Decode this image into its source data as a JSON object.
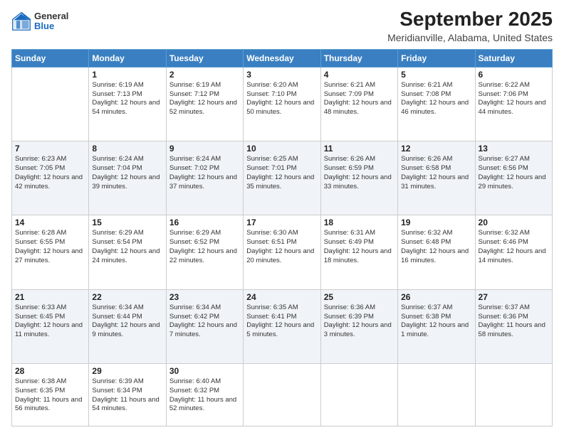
{
  "logo": {
    "general": "General",
    "blue": "Blue"
  },
  "title": "September 2025",
  "subtitle": "Meridianville, Alabama, United States",
  "weekdays": [
    "Sunday",
    "Monday",
    "Tuesday",
    "Wednesday",
    "Thursday",
    "Friday",
    "Saturday"
  ],
  "rows": [
    [
      {
        "day": "",
        "sunrise": "",
        "sunset": "",
        "daylight": "",
        "empty": true
      },
      {
        "day": "1",
        "sunrise": "Sunrise: 6:19 AM",
        "sunset": "Sunset: 7:13 PM",
        "daylight": "Daylight: 12 hours and 54 minutes."
      },
      {
        "day": "2",
        "sunrise": "Sunrise: 6:19 AM",
        "sunset": "Sunset: 7:12 PM",
        "daylight": "Daylight: 12 hours and 52 minutes."
      },
      {
        "day": "3",
        "sunrise": "Sunrise: 6:20 AM",
        "sunset": "Sunset: 7:10 PM",
        "daylight": "Daylight: 12 hours and 50 minutes."
      },
      {
        "day": "4",
        "sunrise": "Sunrise: 6:21 AM",
        "sunset": "Sunset: 7:09 PM",
        "daylight": "Daylight: 12 hours and 48 minutes."
      },
      {
        "day": "5",
        "sunrise": "Sunrise: 6:21 AM",
        "sunset": "Sunset: 7:08 PM",
        "daylight": "Daylight: 12 hours and 46 minutes."
      },
      {
        "day": "6",
        "sunrise": "Sunrise: 6:22 AM",
        "sunset": "Sunset: 7:06 PM",
        "daylight": "Daylight: 12 hours and 44 minutes."
      }
    ],
    [
      {
        "day": "7",
        "sunrise": "Sunrise: 6:23 AM",
        "sunset": "Sunset: 7:05 PM",
        "daylight": "Daylight: 12 hours and 42 minutes."
      },
      {
        "day": "8",
        "sunrise": "Sunrise: 6:24 AM",
        "sunset": "Sunset: 7:04 PM",
        "daylight": "Daylight: 12 hours and 39 minutes."
      },
      {
        "day": "9",
        "sunrise": "Sunrise: 6:24 AM",
        "sunset": "Sunset: 7:02 PM",
        "daylight": "Daylight: 12 hours and 37 minutes."
      },
      {
        "day": "10",
        "sunrise": "Sunrise: 6:25 AM",
        "sunset": "Sunset: 7:01 PM",
        "daylight": "Daylight: 12 hours and 35 minutes."
      },
      {
        "day": "11",
        "sunrise": "Sunrise: 6:26 AM",
        "sunset": "Sunset: 6:59 PM",
        "daylight": "Daylight: 12 hours and 33 minutes."
      },
      {
        "day": "12",
        "sunrise": "Sunrise: 6:26 AM",
        "sunset": "Sunset: 6:58 PM",
        "daylight": "Daylight: 12 hours and 31 minutes."
      },
      {
        "day": "13",
        "sunrise": "Sunrise: 6:27 AM",
        "sunset": "Sunset: 6:56 PM",
        "daylight": "Daylight: 12 hours and 29 minutes."
      }
    ],
    [
      {
        "day": "14",
        "sunrise": "Sunrise: 6:28 AM",
        "sunset": "Sunset: 6:55 PM",
        "daylight": "Daylight: 12 hours and 27 minutes."
      },
      {
        "day": "15",
        "sunrise": "Sunrise: 6:29 AM",
        "sunset": "Sunset: 6:54 PM",
        "daylight": "Daylight: 12 hours and 24 minutes."
      },
      {
        "day": "16",
        "sunrise": "Sunrise: 6:29 AM",
        "sunset": "Sunset: 6:52 PM",
        "daylight": "Daylight: 12 hours and 22 minutes."
      },
      {
        "day": "17",
        "sunrise": "Sunrise: 6:30 AM",
        "sunset": "Sunset: 6:51 PM",
        "daylight": "Daylight: 12 hours and 20 minutes."
      },
      {
        "day": "18",
        "sunrise": "Sunrise: 6:31 AM",
        "sunset": "Sunset: 6:49 PM",
        "daylight": "Daylight: 12 hours and 18 minutes."
      },
      {
        "day": "19",
        "sunrise": "Sunrise: 6:32 AM",
        "sunset": "Sunset: 6:48 PM",
        "daylight": "Daylight: 12 hours and 16 minutes."
      },
      {
        "day": "20",
        "sunrise": "Sunrise: 6:32 AM",
        "sunset": "Sunset: 6:46 PM",
        "daylight": "Daylight: 12 hours and 14 minutes."
      }
    ],
    [
      {
        "day": "21",
        "sunrise": "Sunrise: 6:33 AM",
        "sunset": "Sunset: 6:45 PM",
        "daylight": "Daylight: 12 hours and 11 minutes."
      },
      {
        "day": "22",
        "sunrise": "Sunrise: 6:34 AM",
        "sunset": "Sunset: 6:44 PM",
        "daylight": "Daylight: 12 hours and 9 minutes."
      },
      {
        "day": "23",
        "sunrise": "Sunrise: 6:34 AM",
        "sunset": "Sunset: 6:42 PM",
        "daylight": "Daylight: 12 hours and 7 minutes."
      },
      {
        "day": "24",
        "sunrise": "Sunrise: 6:35 AM",
        "sunset": "Sunset: 6:41 PM",
        "daylight": "Daylight: 12 hours and 5 minutes."
      },
      {
        "day": "25",
        "sunrise": "Sunrise: 6:36 AM",
        "sunset": "Sunset: 6:39 PM",
        "daylight": "Daylight: 12 hours and 3 minutes."
      },
      {
        "day": "26",
        "sunrise": "Sunrise: 6:37 AM",
        "sunset": "Sunset: 6:38 PM",
        "daylight": "Daylight: 12 hours and 1 minute."
      },
      {
        "day": "27",
        "sunrise": "Sunrise: 6:37 AM",
        "sunset": "Sunset: 6:36 PM",
        "daylight": "Daylight: 11 hours and 58 minutes."
      }
    ],
    [
      {
        "day": "28",
        "sunrise": "Sunrise: 6:38 AM",
        "sunset": "Sunset: 6:35 PM",
        "daylight": "Daylight: 11 hours and 56 minutes."
      },
      {
        "day": "29",
        "sunrise": "Sunrise: 6:39 AM",
        "sunset": "Sunset: 6:34 PM",
        "daylight": "Daylight: 11 hours and 54 minutes."
      },
      {
        "day": "30",
        "sunrise": "Sunrise: 6:40 AM",
        "sunset": "Sunset: 6:32 PM",
        "daylight": "Daylight: 11 hours and 52 minutes."
      },
      {
        "day": "",
        "sunrise": "",
        "sunset": "",
        "daylight": "",
        "empty": true
      },
      {
        "day": "",
        "sunrise": "",
        "sunset": "",
        "daylight": "",
        "empty": true
      },
      {
        "day": "",
        "sunrise": "",
        "sunset": "",
        "daylight": "",
        "empty": true
      },
      {
        "day": "",
        "sunrise": "",
        "sunset": "",
        "daylight": "",
        "empty": true
      }
    ]
  ]
}
